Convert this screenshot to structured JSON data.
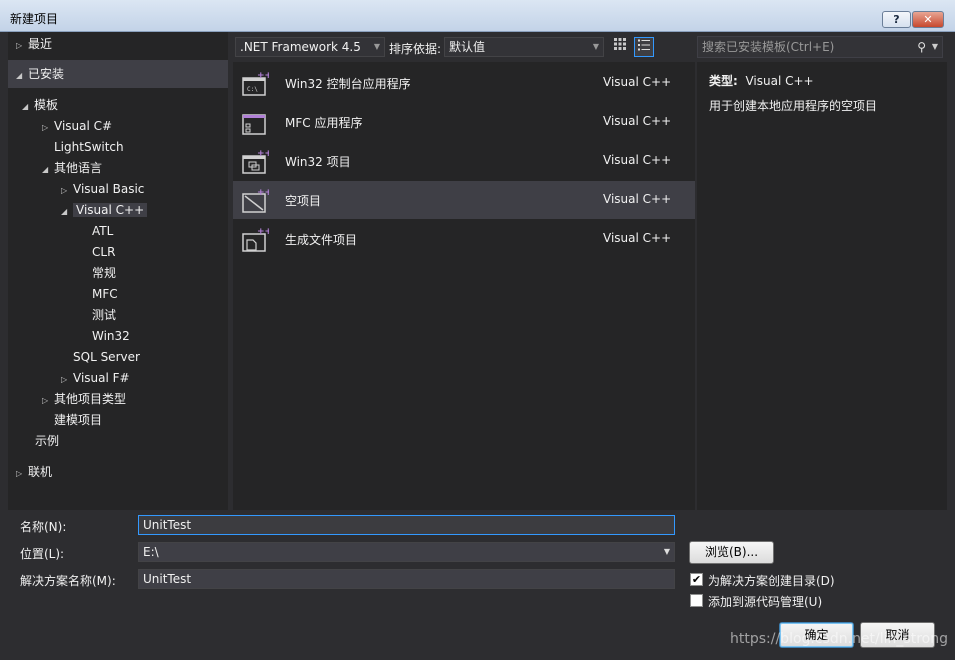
{
  "window": {
    "title": "新建项目",
    "help": "?",
    "close": "✕"
  },
  "tree": {
    "recent": "最近",
    "installed": "已安装",
    "templates": "模板",
    "visual_csharp": "Visual C#",
    "lightswitch": "LightSwitch",
    "other_languages": "其他语言",
    "visual_basic": "Visual Basic",
    "visual_cpp": "Visual C++",
    "atl": "ATL",
    "clr": "CLR",
    "general": "常规",
    "mfc": "MFC",
    "test": "测试",
    "win32": "Win32",
    "sql_server": "SQL Server",
    "visual_fsharp": "Visual F#",
    "other_project_types": "其他项目类型",
    "modeling_projects": "建模项目",
    "samples": "示例",
    "online": "联机"
  },
  "toolbar": {
    "framework": ".NET Framework 4.5",
    "sort_label": "排序依据:",
    "sort_value": "默认值"
  },
  "search": {
    "placeholder": "搜索已安装模板(Ctrl+E)"
  },
  "templates": [
    {
      "name": "Win32 控制台应用程序",
      "lang": "Visual C++"
    },
    {
      "name": "MFC 应用程序",
      "lang": "Visual C++"
    },
    {
      "name": "Win32 项目",
      "lang": "Visual C++"
    },
    {
      "name": "空项目",
      "lang": "Visual C++"
    },
    {
      "name": "生成文件项目",
      "lang": "Visual C++"
    }
  ],
  "details": {
    "type_label": "类型:",
    "type_value": "Visual C++",
    "description": "用于创建本地应用程序的空项目"
  },
  "form": {
    "name_label": "名称(N):",
    "name_value": "UnitTest",
    "location_label": "位置(L):",
    "location_value": "E:\\",
    "solution_label": "解决方案名称(M):",
    "solution_value": "UnitTest",
    "browse": "浏览(B)...",
    "create_dir": "为解决方案创建目录(D)",
    "add_source": "添加到源代码管理(U)",
    "ok": "确定",
    "cancel": "取消"
  },
  "watermark": "https://blog.csdn.net/lin_strong"
}
